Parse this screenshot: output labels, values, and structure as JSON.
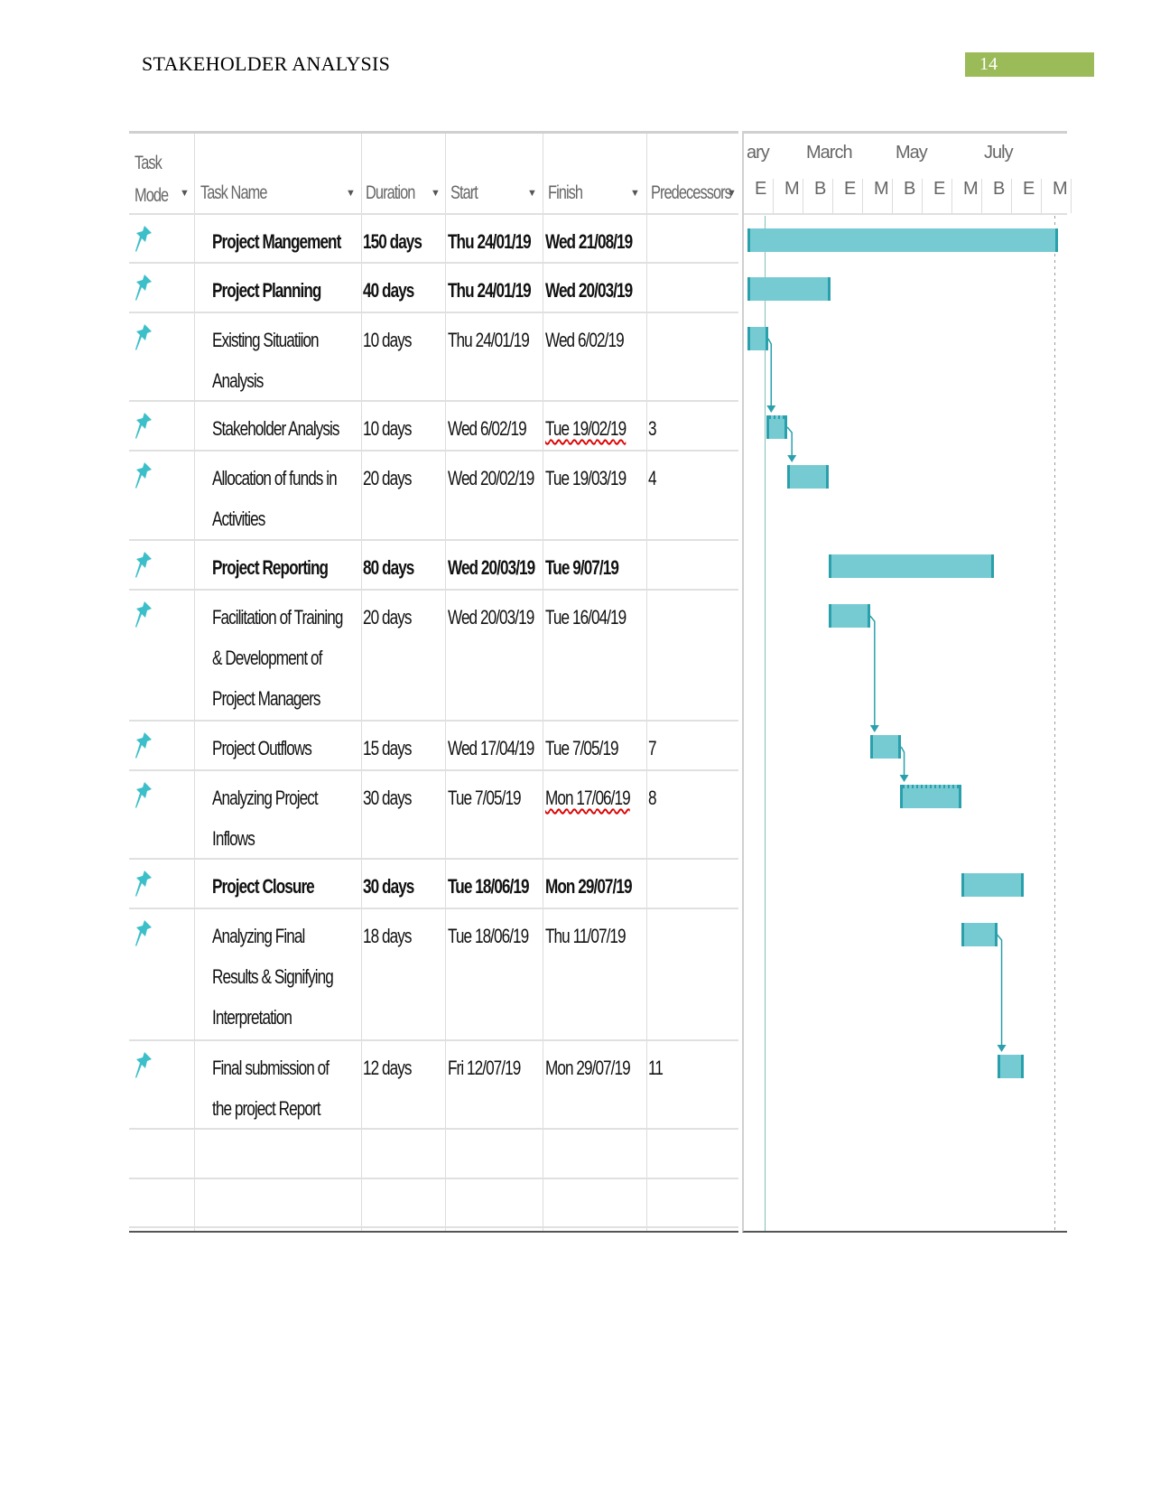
{
  "header": {
    "title": "STAKEHOLDER ANALYSIS",
    "page_number": "14",
    "page_number_color": "#9bbb59"
  },
  "table": {
    "columns": [
      "Task\nMode",
      "Task Name",
      "Duration",
      "Start",
      "Finish",
      "Predecessors"
    ],
    "rows": [
      {
        "name": "Project Mangement",
        "duration": "150 days",
        "start": "Thu 24/01/19",
        "finish": "Wed 21/08/19",
        "pred": "",
        "summary": true
      },
      {
        "name": "Project Planning",
        "duration": "40 days",
        "start": "Thu 24/01/19",
        "finish": "Wed 20/03/19",
        "pred": "",
        "summary": true
      },
      {
        "name": "Existing Situatiion\nAnalysis",
        "duration": "10 days",
        "start": "Thu 24/01/19",
        "finish": "Wed 6/02/19",
        "pred": "",
        "summary": false
      },
      {
        "name": "Stakeholder Analysis",
        "duration": "10 days",
        "start": "Wed 6/02/19",
        "finish": "Tue 19/02/19",
        "pred": "3",
        "summary": false,
        "critical": true,
        "spell": true
      },
      {
        "name": "Allocation of funds in\nActivities",
        "duration": "20 days",
        "start": "Wed 20/02/19",
        "finish": "Tue 19/03/19",
        "pred": "4",
        "summary": false
      },
      {
        "name": "Project Reporting",
        "duration": "80 days",
        "start": "Wed 20/03/19",
        "finish": "Tue 9/07/19",
        "pred": "",
        "summary": true
      },
      {
        "name": "Facilitation of Training\n& Development of\nProject Managers",
        "duration": "20 days",
        "start": "Wed 20/03/19",
        "finish": "Tue 16/04/19",
        "pred": "",
        "summary": false
      },
      {
        "name": "Project Outflows",
        "duration": "15 days",
        "start": "Wed 17/04/19",
        "finish": "Tue 7/05/19",
        "pred": "7",
        "summary": false
      },
      {
        "name": "Analyzing Project\nInflows",
        "duration": "30 days",
        "start": "Tue 7/05/19",
        "finish": "Mon 17/06/19",
        "pred": "8",
        "summary": false,
        "critical": true,
        "spell": true
      },
      {
        "name": "Project Closure",
        "duration": "30 days",
        "start": "Tue 18/06/19",
        "finish": "Mon 29/07/19",
        "pred": "",
        "summary": true
      },
      {
        "name": "Analyzing Final\nResults & Signifying\nInterpretation",
        "duration": "18 days",
        "start": "Tue 18/06/19",
        "finish": "Thu 11/07/19",
        "pred": "",
        "summary": false
      },
      {
        "name": "Final submission of\nthe project Report",
        "duration": "12 days",
        "start": "Fri 12/07/19",
        "finish": "Mon 29/07/19",
        "pred": "11",
        "summary": false
      }
    ]
  },
  "timescale": {
    "top": [
      "ary",
      "March",
      "May",
      "July"
    ],
    "bottom": [
      "E",
      "M",
      "B",
      "E",
      "M",
      "B",
      "E",
      "M",
      "B",
      "E",
      "M"
    ]
  },
  "colors": {
    "bar": "#76cbd3",
    "bar_edge": "#2aa0ac",
    "pin": "#3cbfc9"
  },
  "icons": {
    "task_mode": "pin-icon",
    "column_menu": "dropdown-arrow-icon"
  }
}
